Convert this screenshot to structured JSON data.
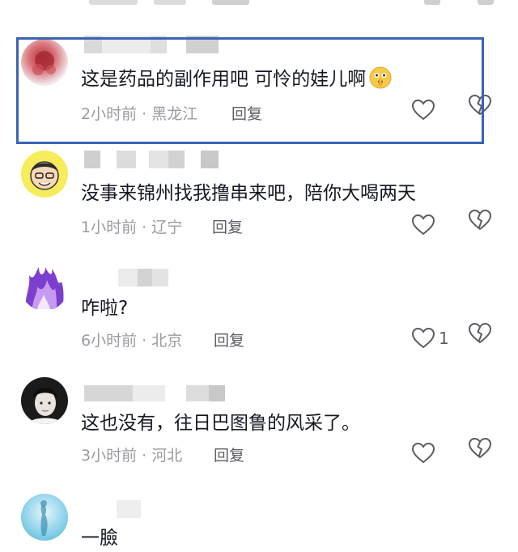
{
  "comments": [
    {
      "text": "这是药品的副作用吧   可怜的娃儿啊",
      "time": "2小时前",
      "sep": "·",
      "location": "黑龙江",
      "reply_label": "回复",
      "like_count": ""
    },
    {
      "text": "没事来锦州找我撸串来吧，陪你大喝两天",
      "time": "1小时前",
      "sep": "·",
      "location": "辽宁",
      "reply_label": "回复",
      "like_count": ""
    },
    {
      "text": "咋啦?",
      "time": "6小时前",
      "sep": "·",
      "location": "北京",
      "reply_label": "回复",
      "like_count": "1"
    },
    {
      "text": "这也没有，往日巴图鲁的风采了。",
      "time": "3小时前",
      "sep": "·",
      "location": "河北",
      "reply_label": "回复",
      "like_count": ""
    },
    {
      "text": "一臉",
      "time": "",
      "sep": "",
      "location": "",
      "reply_label": "",
      "like_count": ""
    }
  ],
  "icons": {
    "emoji": "shushing-face-emoji-icon",
    "like": "heart-outline-icon",
    "dislike": "broken-heart-icon"
  },
  "colors": {
    "text": "#161823",
    "meta": "#9a9ba1",
    "reply": "#5b5c63",
    "highlight": "#3b63b5"
  }
}
